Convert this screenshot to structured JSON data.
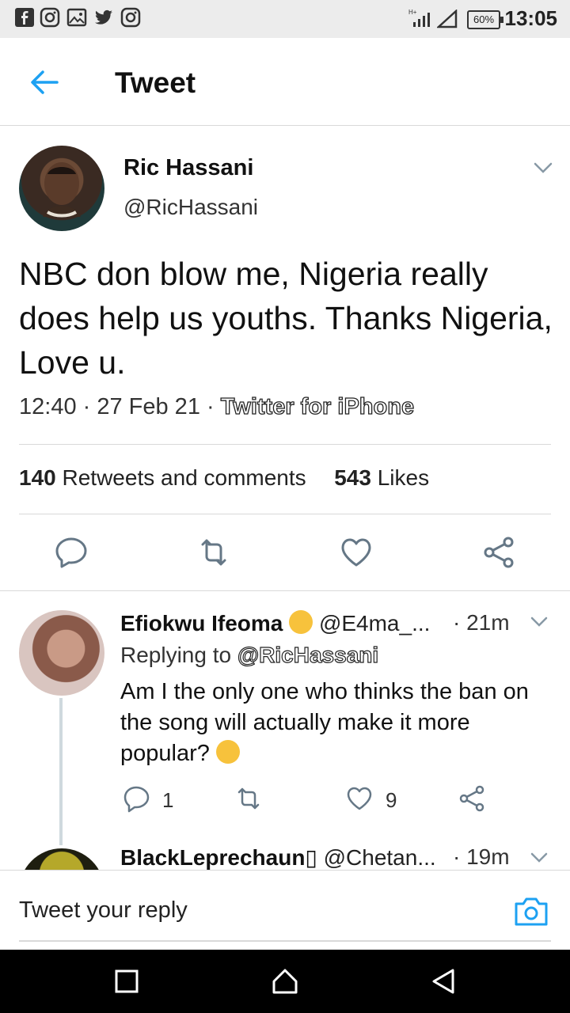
{
  "status_bar": {
    "time": "13:05",
    "battery": "60%",
    "icons": [
      "facebook-icon",
      "instagram-icon",
      "gallery-icon",
      "twitter-icon",
      "instagram-icon"
    ]
  },
  "header": {
    "title": "Tweet"
  },
  "tweet": {
    "author_name": "Ric Hassani",
    "author_handle": "@RicHassani",
    "text": "NBC don blow me, Nigeria really does help us youths. Thanks Nigeria, Love u.",
    "time": "12:40 · 27 Feb 21 · ",
    "source": "Twitter for iPhone",
    "retweets_count": "140",
    "retweets_label": "Retweets and comments",
    "likes_count": "543",
    "likes_label": "Likes"
  },
  "replies": [
    {
      "name": "Efiokwu Ifeoma",
      "handle": "@E4ma_...",
      "time": "· 21m",
      "replying_prefix": "Replying to ",
      "replying_to": "@RicHassani",
      "text": "Am I the only one who thinks the ban on the song will actually make it more popular?",
      "reply_count": "1",
      "like_count": "9"
    },
    {
      "name": "BlackLeprechaun▯",
      "handle": "@Chetan...",
      "time": "· 19m"
    }
  ],
  "compose": {
    "placeholder": "Tweet your reply"
  },
  "colors": {
    "accent": "#1da1f2",
    "icon_gray": "#657786"
  }
}
